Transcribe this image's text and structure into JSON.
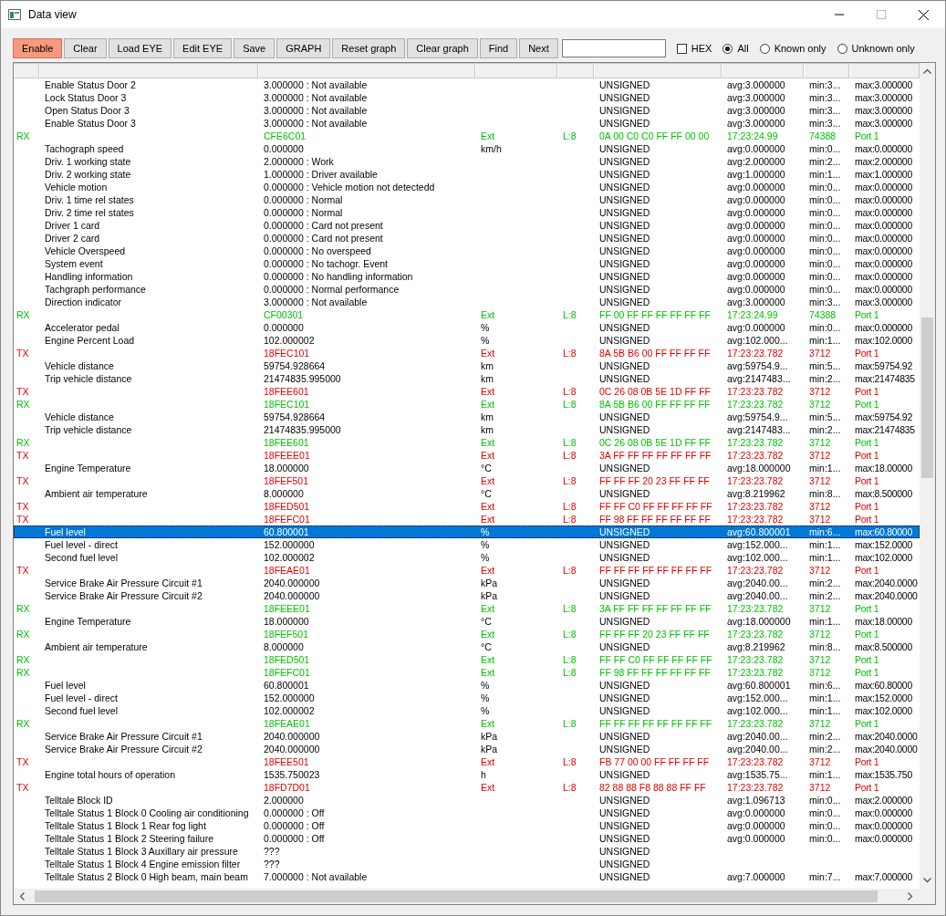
{
  "window": {
    "title": "Data view"
  },
  "toolbar": {
    "buttons": [
      {
        "label": "Enable",
        "on": true
      },
      {
        "label": "Clear",
        "on": false
      },
      {
        "label": "Load EYE",
        "on": false
      },
      {
        "label": "Edit EYE",
        "on": false
      },
      {
        "label": "Save",
        "on": false
      },
      {
        "label": "GRAPH",
        "on": false
      },
      {
        "label": "Reset graph",
        "on": false
      },
      {
        "label": "Clear graph",
        "on": false
      },
      {
        "label": "Find",
        "on": false
      },
      {
        "label": "Next",
        "on": false
      }
    ],
    "hex": {
      "label": "HEX",
      "checked": false
    },
    "filters": [
      {
        "label": "All",
        "selected": true
      },
      {
        "label": "Known only",
        "selected": false
      },
      {
        "label": "Unknown only",
        "selected": false
      }
    ]
  },
  "rows": [
    {
      "kind": "signal",
      "selected": false,
      "name": "Enable Status Door 2",
      "value": "3.000000 : Not available",
      "type": "UNSIGNED",
      "avg": "avg:3.000000",
      "min": "min:3...",
      "max": "max:3.000000"
    },
    {
      "kind": "signal",
      "selected": false,
      "name": "Lock Status Door 3",
      "value": "3.000000 : Not available",
      "type": "UNSIGNED",
      "avg": "avg:3.000000",
      "min": "min:3...",
      "max": "max:3.000000"
    },
    {
      "kind": "signal",
      "selected": false,
      "name": "Open Status Door 3",
      "value": "3.000000 : Not available",
      "type": "UNSIGNED",
      "avg": "avg:3.000000",
      "min": "min:3...",
      "max": "max:3.000000"
    },
    {
      "kind": "signal",
      "selected": false,
      "name": "Enable Status Door 3",
      "value": "3.000000 : Not available",
      "type": "UNSIGNED",
      "avg": "avg:3.000000",
      "min": "min:3...",
      "max": "max:3.000000"
    },
    {
      "kind": "frame",
      "selected": false,
      "color": "#00c000",
      "dir": "RX",
      "id": "CFE6C01",
      "ext": "Ext",
      "len": "L:8",
      "data": "0A 00 C0 C0 FF FF 00 00",
      "time": "17:23:24.99",
      "count": "74388",
      "port": "Port 1"
    },
    {
      "kind": "signal",
      "selected": false,
      "name": "Tachograph speed",
      "value": "0.000000",
      "unit": "km/h",
      "type": "UNSIGNED",
      "avg": "avg:0.000000",
      "min": "min:0...",
      "max": "max:0.000000"
    },
    {
      "kind": "signal",
      "selected": false,
      "name": "Driv. 1 working state",
      "value": "2.000000 : Work",
      "type": "UNSIGNED",
      "avg": "avg:2.000000",
      "min": "min:2...",
      "max": "max:2.000000"
    },
    {
      "kind": "signal",
      "selected": false,
      "name": "Driv. 2 working state",
      "value": "1.000000 : Driver available",
      "type": "UNSIGNED",
      "avg": "avg:1.000000",
      "min": "min:1...",
      "max": "max:1.000000"
    },
    {
      "kind": "signal",
      "selected": false,
      "name": "Vehicle motion",
      "value": "0.000000 : Vehicle motion not detectedd",
      "type": "UNSIGNED",
      "avg": "avg:0.000000",
      "min": "min:0...",
      "max": "max:0.000000"
    },
    {
      "kind": "signal",
      "selected": false,
      "name": "Driv. 1 time rel states",
      "value": "0.000000 : Normal",
      "type": "UNSIGNED",
      "avg": "avg:0.000000",
      "min": "min:0...",
      "max": "max:0.000000"
    },
    {
      "kind": "signal",
      "selected": false,
      "name": "Driv. 2 time rel states",
      "value": "0.000000 : Normal",
      "type": "UNSIGNED",
      "avg": "avg:0.000000",
      "min": "min:0...",
      "max": "max:0.000000"
    },
    {
      "kind": "signal",
      "selected": false,
      "name": "Driver 1 card",
      "value": "0.000000 : Card not present",
      "type": "UNSIGNED",
      "avg": "avg:0.000000",
      "min": "min:0...",
      "max": "max:0.000000"
    },
    {
      "kind": "signal",
      "selected": false,
      "name": "Driver 2 card",
      "value": "0.000000 : Card not present",
      "type": "UNSIGNED",
      "avg": "avg:0.000000",
      "min": "min:0...",
      "max": "max:0.000000"
    },
    {
      "kind": "signal",
      "selected": false,
      "name": "Vehicle Overspeed",
      "value": "0.000000 : No overspeed",
      "type": "UNSIGNED",
      "avg": "avg:0.000000",
      "min": "min:0...",
      "max": "max:0.000000"
    },
    {
      "kind": "signal",
      "selected": false,
      "name": "System event",
      "value": "0.000000 : No tachogr. Event",
      "type": "UNSIGNED",
      "avg": "avg:0.000000",
      "min": "min:0...",
      "max": "max:0.000000"
    },
    {
      "kind": "signal",
      "selected": false,
      "name": "Handling information",
      "value": "0.000000 : No handling information",
      "type": "UNSIGNED",
      "avg": "avg:0.000000",
      "min": "min:0...",
      "max": "max:0.000000"
    },
    {
      "kind": "signal",
      "selected": false,
      "name": "Tachgraph performance",
      "value": "0.000000 : Normal performance",
      "type": "UNSIGNED",
      "avg": "avg:0.000000",
      "min": "min:0...",
      "max": "max:0.000000"
    },
    {
      "kind": "signal",
      "selected": false,
      "name": "Direction indicator",
      "value": "3.000000 : Not available",
      "type": "UNSIGNED",
      "avg": "avg:3.000000",
      "min": "min:3...",
      "max": "max:3.000000"
    },
    {
      "kind": "frame",
      "selected": false,
      "color": "#00c000",
      "dir": "RX",
      "id": "CF00301",
      "ext": "Ext",
      "len": "L:8",
      "data": "FF 00 FF FF FF FF FF FF",
      "time": "17:23:24.99",
      "count": "74388",
      "port": "Port 1"
    },
    {
      "kind": "signal",
      "selected": false,
      "name": "Accelerator pedal",
      "value": "0.000000",
      "unit": "%",
      "type": "UNSIGNED",
      "avg": "avg:0.000000",
      "min": "min:0...",
      "max": "max:0.000000"
    },
    {
      "kind": "signal",
      "selected": false,
      "name": "Engine Percent Load",
      "value": "102.000002",
      "unit": "%",
      "type": "UNSIGNED",
      "avg": "avg:102.000...",
      "min": "min:1...",
      "max": "max:102.0000"
    },
    {
      "kind": "frame",
      "selected": false,
      "color": "#e00000",
      "dir": "TX",
      "id": "18FEC101",
      "ext": "Ext",
      "len": "L:8",
      "data": "8A 5B B6 00 FF FF FF FF",
      "time": "17:23:23.782",
      "count": "3712",
      "port": "Port 1"
    },
    {
      "kind": "signal",
      "selected": false,
      "name": "Vehicle distance",
      "value": "59754.928664",
      "unit": "km",
      "type": "UNSIGNED",
      "avg": "avg:59754.9...",
      "min": "min:5...",
      "max": "max:59754.92"
    },
    {
      "kind": "signal",
      "selected": false,
      "name": "Trip vehicle distance",
      "value": "21474835.995000",
      "unit": "km",
      "type": "UNSIGNED",
      "avg": "avg:2147483...",
      "min": "min:2...",
      "max": "max:21474835"
    },
    {
      "kind": "frame",
      "selected": false,
      "color": "#e00000",
      "dir": "TX",
      "id": "18FEE601",
      "ext": "Ext",
      "len": "L:8",
      "data": "0C 26 08 0B 5E 1D FF FF",
      "time": "17:23:23.782",
      "count": "3712",
      "port": "Port 1"
    },
    {
      "kind": "frame",
      "selected": false,
      "color": "#00c000",
      "dir": "RX",
      "id": "18FEC101",
      "ext": "Ext",
      "len": "L:8",
      "data": "8A 5B B6 00 FF FF FF FF",
      "time": "17:23:23.782",
      "count": "3712",
      "port": "Port 1"
    },
    {
      "kind": "signal",
      "selected": false,
      "name": "Vehicle distance",
      "value": "59754.928664",
      "unit": "km",
      "type": "UNSIGNED",
      "avg": "avg:59754.9...",
      "min": "min:5...",
      "max": "max:59754.92"
    },
    {
      "kind": "signal",
      "selected": false,
      "name": "Trip vehicle distance",
      "value": "21474835.995000",
      "unit": "km",
      "type": "UNSIGNED",
      "avg": "avg:2147483...",
      "min": "min:2...",
      "max": "max:21474835"
    },
    {
      "kind": "frame",
      "selected": false,
      "color": "#00c000",
      "dir": "RX",
      "id": "18FEE601",
      "ext": "Ext",
      "len": "L:8",
      "data": "0C 26 08 0B 5E 1D FF FF",
      "time": "17:23:23.782",
      "count": "3712",
      "port": "Port 1"
    },
    {
      "kind": "frame",
      "selected": false,
      "color": "#e00000",
      "dir": "TX",
      "id": "18FEEE01",
      "ext": "Ext",
      "len": "L:8",
      "data": "3A FF FF FF FF FF FF FF",
      "time": "17:23:23.782",
      "count": "3712",
      "port": "Port 1"
    },
    {
      "kind": "signal",
      "selected": false,
      "name": "Engine Temperature",
      "value": "18.000000",
      "unit": "°C",
      "type": "UNSIGNED",
      "avg": "avg:18.000000",
      "min": "min:1...",
      "max": "max:18.00000"
    },
    {
      "kind": "frame",
      "selected": false,
      "color": "#e00000",
      "dir": "TX",
      "id": "18FEF501",
      "ext": "Ext",
      "len": "L:8",
      "data": "FF FF FF 20 23 FF FF FF",
      "time": "17:23:23.782",
      "count": "3712",
      "port": "Port 1"
    },
    {
      "kind": "signal",
      "selected": false,
      "name": "Ambient air temperature",
      "value": "8.000000",
      "unit": "°C",
      "type": "UNSIGNED",
      "avg": "avg:8.219962",
      "min": "min:8...",
      "max": "max:8.500000"
    },
    {
      "kind": "frame",
      "selected": false,
      "color": "#e00000",
      "dir": "TX",
      "id": "18FED501",
      "ext": "Ext",
      "len": "L:8",
      "data": "FF FF C0 FF FF FF FF FF",
      "time": "17:23:23.782",
      "count": "3712",
      "port": "Port 1"
    },
    {
      "kind": "frame",
      "selected": false,
      "color": "#e00000",
      "dir": "TX",
      "id": "18FEFC01",
      "ext": "Ext",
      "len": "L:8",
      "data": "FF 98 FF FF FF FF FF FF",
      "time": "17:23:23.782",
      "count": "3712",
      "port": "Port 1"
    },
    {
      "kind": "signal",
      "selected": true,
      "name": "Fuel level",
      "value": "60.800001",
      "unit": "%",
      "type": "UNSIGNED",
      "avg": "avg:60.800001",
      "min": "min:6...",
      "max": "max:60.80000"
    },
    {
      "kind": "signal",
      "selected": false,
      "name": "Fuel level - direct",
      "value": "152.000000",
      "unit": "%",
      "type": "UNSIGNED",
      "avg": "avg:152.000...",
      "min": "min:1...",
      "max": "max:152.0000"
    },
    {
      "kind": "signal",
      "selected": false,
      "name": "Second fuel level",
      "value": "102.000002",
      "unit": "%",
      "type": "UNSIGNED",
      "avg": "avg:102.000...",
      "min": "min:1...",
      "max": "max:102.0000"
    },
    {
      "kind": "frame",
      "selected": false,
      "color": "#e00000",
      "dir": "TX",
      "id": "18FEAE01",
      "ext": "Ext",
      "len": "L:8",
      "data": "FF FF FF FF FF FF FF FF",
      "time": "17:23:23.782",
      "count": "3712",
      "port": "Port 1"
    },
    {
      "kind": "signal",
      "selected": false,
      "name": "Service Brake Air Pressure Circuit #1",
      "value": "2040.000000",
      "unit": "kPa",
      "type": "UNSIGNED",
      "avg": "avg:2040.00...",
      "min": "min:2...",
      "max": "max:2040.0000"
    },
    {
      "kind": "signal",
      "selected": false,
      "name": "Service Brake Air Pressure Circuit #2",
      "value": "2040.000000",
      "unit": "kPa",
      "type": "UNSIGNED",
      "avg": "avg:2040.00...",
      "min": "min:2...",
      "max": "max:2040.0000"
    },
    {
      "kind": "frame",
      "selected": false,
      "color": "#00c000",
      "dir": "RX",
      "id": "18FEEE01",
      "ext": "Ext",
      "len": "L:8",
      "data": "3A FF FF FF FF FF FF FF",
      "time": "17:23:23.782",
      "count": "3712",
      "port": "Port 1"
    },
    {
      "kind": "signal",
      "selected": false,
      "name": "Engine Temperature",
      "value": "18.000000",
      "unit": "°C",
      "type": "UNSIGNED",
      "avg": "avg:18.000000",
      "min": "min:1...",
      "max": "max:18.00000"
    },
    {
      "kind": "frame",
      "selected": false,
      "color": "#00c000",
      "dir": "RX",
      "id": "18FEF501",
      "ext": "Ext",
      "len": "L:8",
      "data": "FF FF FF 20 23 FF FF FF",
      "time": "17:23:23.782",
      "count": "3712",
      "port": "Port 1"
    },
    {
      "kind": "signal",
      "selected": false,
      "name": "Ambient air temperature",
      "value": "8.000000",
      "unit": "°C",
      "type": "UNSIGNED",
      "avg": "avg:8.219962",
      "min": "min:8...",
      "max": "max:8.500000"
    },
    {
      "kind": "frame",
      "selected": false,
      "color": "#00c000",
      "dir": "RX",
      "id": "18FED501",
      "ext": "Ext",
      "len": "L:8",
      "data": "FF FF C0 FF FF FF FF FF",
      "time": "17:23:23.782",
      "count": "3712",
      "port": "Port 1"
    },
    {
      "kind": "frame",
      "selected": false,
      "color": "#00c000",
      "dir": "RX",
      "id": "18FEFC01",
      "ext": "Ext",
      "len": "L:8",
      "data": "FF 98 FF FF FF FF FF FF",
      "time": "17:23:23.782",
      "count": "3712",
      "port": "Port 1"
    },
    {
      "kind": "signal",
      "selected": false,
      "name": "Fuel level",
      "value": "60.800001",
      "unit": "%",
      "type": "UNSIGNED",
      "avg": "avg:60.800001",
      "min": "min:6...",
      "max": "max:60.80000"
    },
    {
      "kind": "signal",
      "selected": false,
      "name": "Fuel level - direct",
      "value": "152.000000",
      "unit": "%",
      "type": "UNSIGNED",
      "avg": "avg:152.000...",
      "min": "min:1...",
      "max": "max:152.0000"
    },
    {
      "kind": "signal",
      "selected": false,
      "name": "Second fuel level",
      "value": "102.000002",
      "unit": "%",
      "type": "UNSIGNED",
      "avg": "avg:102.000...",
      "min": "min:1...",
      "max": "max:102.0000"
    },
    {
      "kind": "frame",
      "selected": false,
      "color": "#00c000",
      "dir": "RX",
      "id": "18FEAE01",
      "ext": "Ext",
      "len": "L:8",
      "data": "FF FF FF FF FF FF FF FF",
      "time": "17:23:23.782",
      "count": "3712",
      "port": "Port 1"
    },
    {
      "kind": "signal",
      "selected": false,
      "name": "Service Brake Air Pressure Circuit #1",
      "value": "2040.000000",
      "unit": "kPa",
      "type": "UNSIGNED",
      "avg": "avg:2040.00...",
      "min": "min:2...",
      "max": "max:2040.0000"
    },
    {
      "kind": "signal",
      "selected": false,
      "name": "Service Brake Air Pressure Circuit #2",
      "value": "2040.000000",
      "unit": "kPa",
      "type": "UNSIGNED",
      "avg": "avg:2040.00...",
      "min": "min:2...",
      "max": "max:2040.0000"
    },
    {
      "kind": "frame",
      "selected": false,
      "color": "#e00000",
      "dir": "TX",
      "id": "18FEE501",
      "ext": "Ext",
      "len": "L:8",
      "data": "FB 77 00 00 FF FF FF FF",
      "time": "17:23:23.782",
      "count": "3712",
      "port": "Port 1"
    },
    {
      "kind": "signal",
      "selected": false,
      "name": "Engine total hours of operation",
      "value": "1535.750023",
      "unit": "h",
      "type": "UNSIGNED",
      "avg": "avg:1535.75...",
      "min": "min:1...",
      "max": "max:1535.750"
    },
    {
      "kind": "frame",
      "selected": false,
      "color": "#e00000",
      "dir": "TX",
      "id": "18FD7D01",
      "ext": "Ext",
      "len": "L:8",
      "data": "82 88 88 F8 88 88 FF FF",
      "time": "17:23:23.782",
      "count": "3712",
      "port": "Port 1"
    },
    {
      "kind": "signal",
      "selected": false,
      "name": "Telltale Block ID",
      "value": "2.000000",
      "type": "UNSIGNED",
      "avg": "avg:1.096713",
      "min": "min:0...",
      "max": "max:2.000000"
    },
    {
      "kind": "signal",
      "selected": false,
      "name": "Telltale Status 1 Block 0 Cooling air conditioning",
      "value": "0.000000 : Off",
      "type": "UNSIGNED",
      "avg": "avg:0.000000",
      "min": "min:0...",
      "max": "max:0.000000"
    },
    {
      "kind": "signal",
      "selected": false,
      "name": "Telltale Status 1 Block 1 Rear fog light",
      "value": "0.000000 : Off",
      "type": "UNSIGNED",
      "avg": "avg:0.000000",
      "min": "min:0...",
      "max": "max:0.000000"
    },
    {
      "kind": "signal",
      "selected": false,
      "name": "Telltale Status 1 Block 2 Steering failure",
      "value": "0.000000 : Off",
      "type": "UNSIGNED",
      "avg": "avg:0.000000",
      "min": "min:0...",
      "max": "max:0.000000"
    },
    {
      "kind": "signal",
      "selected": false,
      "name": "Telltale Status 1 Block 3 Auxillary air pressure",
      "value": "???",
      "type": "UNSIGNED"
    },
    {
      "kind": "signal",
      "selected": false,
      "name": "Telltale Status 1 Block 4 Engine emission filter",
      "value": "???",
      "type": "UNSIGNED"
    },
    {
      "kind": "signal",
      "selected": false,
      "name": "Telltale Status 2 Block 0 High beam, main beam",
      "value": "7.000000 : Not available",
      "type": "UNSIGNED",
      "avg": "avg:7.000000",
      "min": "min:7...",
      "max": "max:7.000000"
    }
  ]
}
